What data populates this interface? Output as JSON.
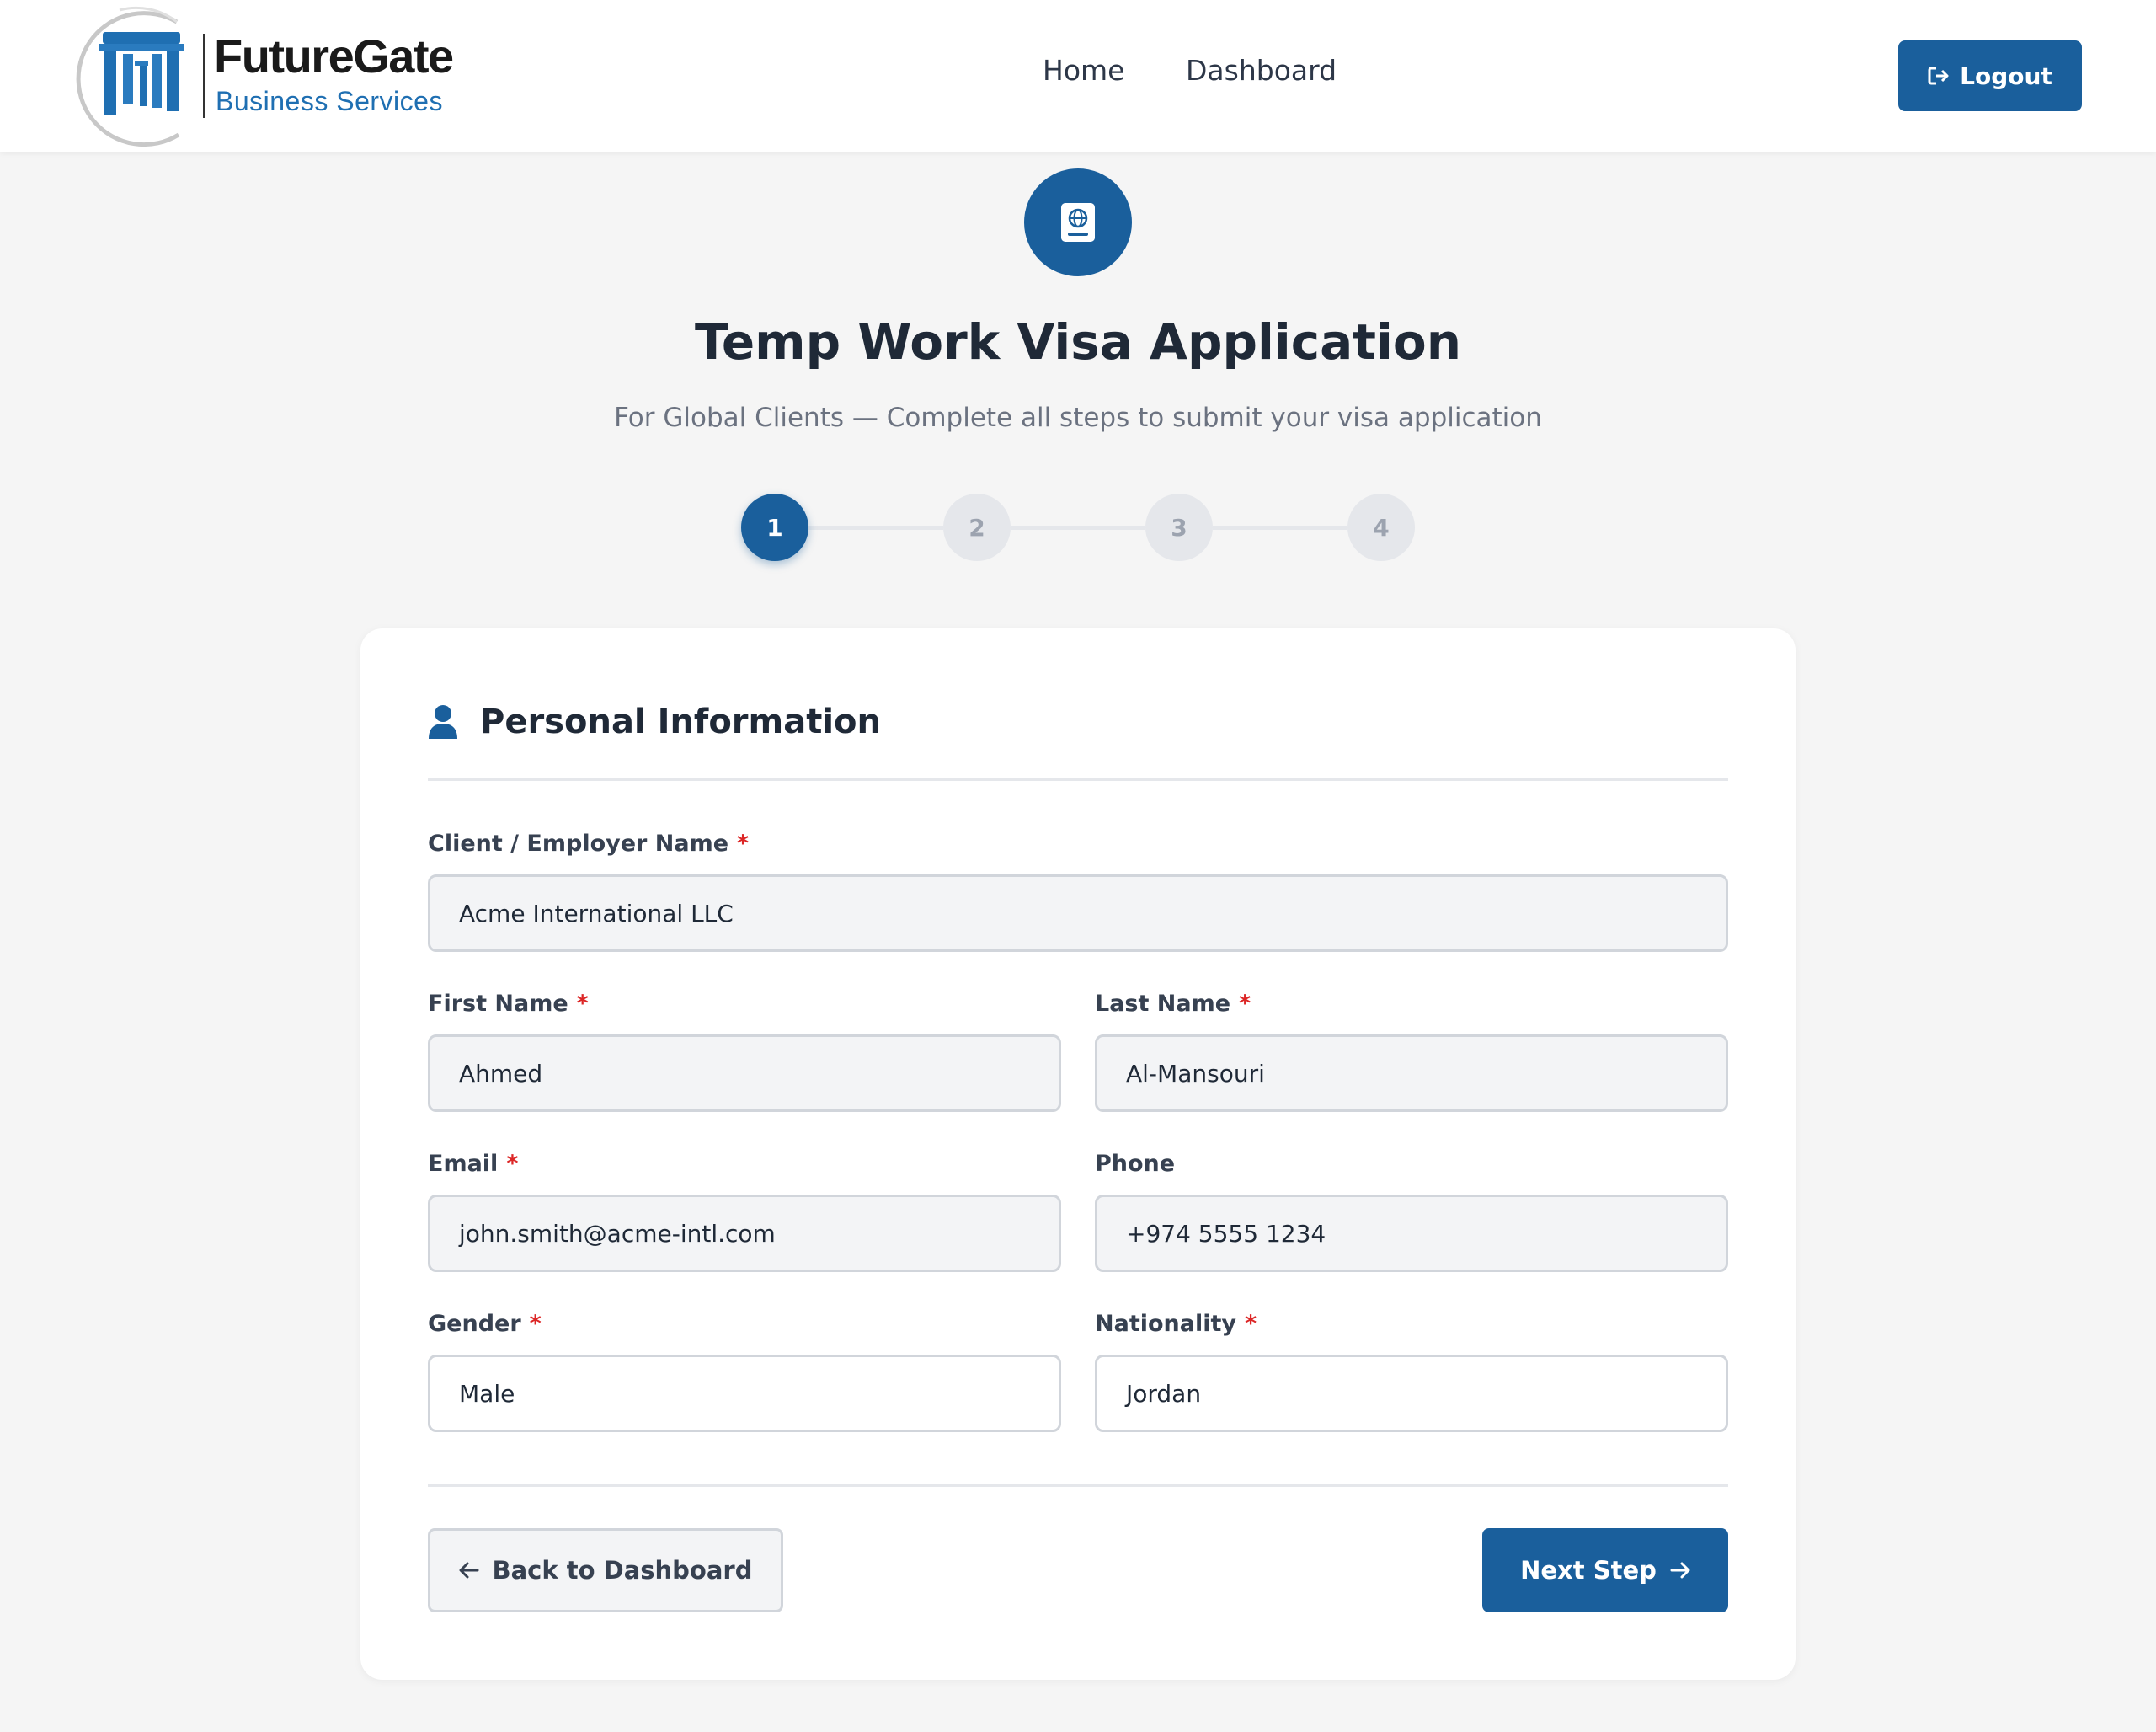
{
  "brand": {
    "name": "FutureGate",
    "tagline": "Business Services"
  },
  "nav": {
    "items": [
      {
        "label": "Home"
      },
      {
        "label": "Dashboard"
      }
    ],
    "logout_label": "Logout"
  },
  "hero": {
    "icon": "passport-icon",
    "title": "Temp Work Visa Application",
    "subtitle": "For Global Clients — Complete all steps to submit your visa application"
  },
  "stepper": {
    "steps": [
      "1",
      "2",
      "3",
      "4"
    ],
    "current_step": 1
  },
  "form": {
    "section_title": "Personal Information",
    "section_icon": "user-icon",
    "fields": {
      "client_name": {
        "label": "Client / Employer Name",
        "required": "*",
        "value": "Acme International LLC"
      },
      "first_name": {
        "label": "First Name",
        "required": "*",
        "value": "Ahmed"
      },
      "last_name": {
        "label": "Last Name",
        "required": "*",
        "value": "Al-Mansouri"
      },
      "email": {
        "label": "Email",
        "required": "*",
        "value": "john.smith@acme-intl.com"
      },
      "phone": {
        "label": "Phone",
        "value": "+974 5555 1234"
      },
      "gender": {
        "label": "Gender",
        "required": "*",
        "value": "Male"
      },
      "nationality": {
        "label": "Nationality",
        "required": "*",
        "value": "Jordan"
      }
    },
    "back_label": "Back to Dashboard",
    "next_label": "Next Step"
  },
  "colors": {
    "primary": "#1a5f9c",
    "required": "#dc2626",
    "background": "#f5f5f5"
  }
}
